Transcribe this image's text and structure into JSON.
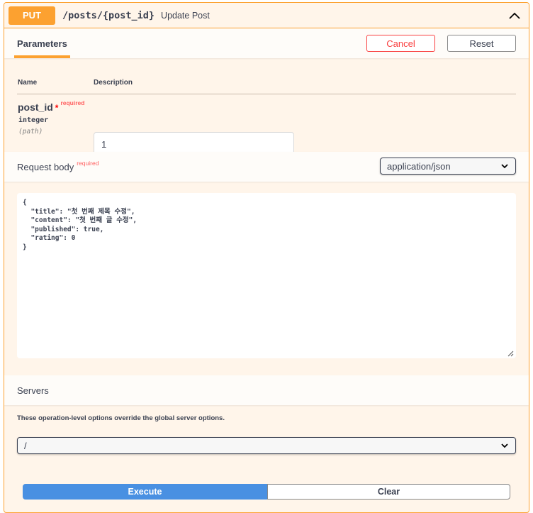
{
  "operation": {
    "method": "PUT",
    "path": "/posts/{post_id}",
    "summary": "Update Post"
  },
  "parameters": {
    "tab_label": "Parameters",
    "cancel_label": "Cancel",
    "reset_label": "Reset",
    "col_name": "Name",
    "col_description": "Description",
    "items": [
      {
        "name": "post_id",
        "required_star": "*",
        "required_label": "required",
        "type": "integer",
        "in": "(path)",
        "value": "1"
      }
    ]
  },
  "request_body": {
    "title": "Request body",
    "required_label": "required",
    "content_type": "application/json",
    "body": "{\n  \"title\": \"첫 번째 제목 수정\",\n  \"content\": \"첫 번째 글 수정\",\n  \"published\": true,\n  \"rating\": 0\n}"
  },
  "servers": {
    "title": "Servers",
    "note": "These operation-level options override the global server options.",
    "selected": "/"
  },
  "actions": {
    "execute_label": "Execute",
    "clear_label": "Clear"
  },
  "colors": {
    "put_accent": "#fca130",
    "cancel_red": "#f93e3e",
    "execute_blue": "#4990e2"
  }
}
